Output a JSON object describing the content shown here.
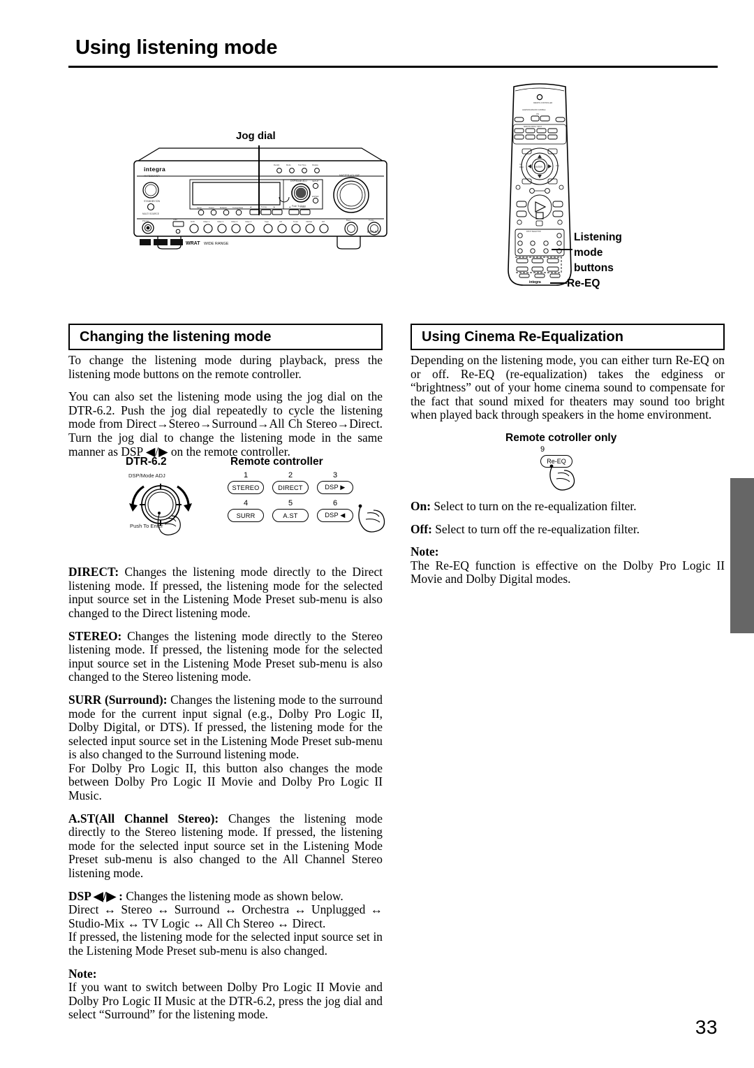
{
  "page": {
    "title": "Using listening mode",
    "number": "33"
  },
  "figures": {
    "receiver": {
      "callout": "Jog dial",
      "brand": "integra",
      "model": "DTR-6.2"
    },
    "remote": {
      "callout_line1": "Listening",
      "callout_line2": "mode",
      "callout_line3": "buttons",
      "callout_line4": "Re-EQ",
      "brand": "integra",
      "input_selector_label": "INPUT SELECTOR"
    },
    "button_diagram": {
      "dtr_heading": "DTR-6.2",
      "remote_heading": "Remote controller",
      "jog_top_label": "DSP/Mode ADJ",
      "jog_bottom_label": "Push To Enter",
      "buttons": [
        {
          "num": "1",
          "label": "STEREO"
        },
        {
          "num": "2",
          "label": "DIRECT"
        },
        {
          "num": "3",
          "label": "DSP ▶"
        },
        {
          "num": "4",
          "label": "SURR"
        },
        {
          "num": "5",
          "label": "A.ST"
        },
        {
          "num": "6",
          "label": "DSP ◀"
        }
      ]
    },
    "reeq_diagram": {
      "heading": "Remote cotroller only",
      "num": "9",
      "button_label": "Re-EQ"
    }
  },
  "sections": {
    "left": {
      "heading": "Changing the listening mode",
      "paragraphs": [
        "To change the listening mode during playback, press the listening mode buttons on the remote controller.",
        "You can also set the listening mode using the jog dial on the DTR-6.2. Push the jog dial repeatedly to cycle the listening mode from Direct→Stereo→Surround→All Ch Stereo→Direct. Turn the jog dial to change the listening mode in the same manner as DSP ◀/▶ on the remote controller."
      ],
      "entries": [
        {
          "term": "DIRECT:",
          "text": " Changes the listening mode directly to the Direct listening mode. If pressed, the listening mode for the selected input source set in the Listening Mode Preset sub-menu is also changed to the Direct listening mode."
        },
        {
          "term": "STEREO:",
          "text": " Changes the listening mode directly to the Stereo listening mode. If pressed, the listening mode for the selected input source set in the Listening Mode Preset sub-menu is also changed to the Stereo listening mode."
        },
        {
          "term": "SURR (Surround):",
          "text": " Changes the listening mode to the surround mode for the current input signal (e.g., Dolby Pro Logic II, Dolby Digital, or DTS). If pressed, the listening mode for the selected input source set in the Listening Mode Preset sub-menu is also changed to the Surround listening mode."
        }
      ],
      "surr_extra": "For Dolby Pro Logic II, this button also changes the mode between Dolby Pro Logic II Movie and Dolby Pro Logic II Music.",
      "ast": {
        "term": "A.ST(All Channel Stereo):",
        "text": " Changes the listening mode directly to the Stereo listening mode. If pressed, the listening mode for the selected input source set in the Listening Mode Preset sub-menu is also changed to the All Channel Stereo listening mode."
      },
      "dsp": {
        "term": "DSP ◀/▶ :",
        "text": " Changes the listening mode as shown below.",
        "chain": "Direct ↔ Stereo ↔ Surround ↔ Orchestra ↔ Unplugged ↔ Studio-Mix ↔ TV Logic ↔ All Ch Stereo ↔ Direct.",
        "after": "If pressed, the listening mode for the selected input source set in the Listening Mode Preset sub-menu is also changed."
      },
      "note": {
        "label": "Note:",
        "text": "If you want to switch between Dolby Pro Logic II Movie and Dolby Pro Logic II Music at the DTR-6.2, press the jog dial and select “Surround” for the listening mode."
      }
    },
    "right": {
      "heading": "Using Cinema Re-Equalization",
      "intro": "Depending on the listening mode, you can either turn Re-EQ on or off. Re-EQ (re-equalization) takes the edginess or “brightness” out of your home cinema sound to compensate for the fact that sound mixed for theaters may sound too bright when played back through speakers in the home environment.",
      "on": {
        "term": "On:",
        "text": " Select to turn on the re-equalization filter."
      },
      "off": {
        "term": "Off:",
        "text": " Select to turn off the re-equalization filter."
      },
      "note": {
        "label": "Note:",
        "text": "The Re-EQ function is effective on the Dolby Pro Logic II Movie and Dolby Digital modes."
      }
    }
  }
}
